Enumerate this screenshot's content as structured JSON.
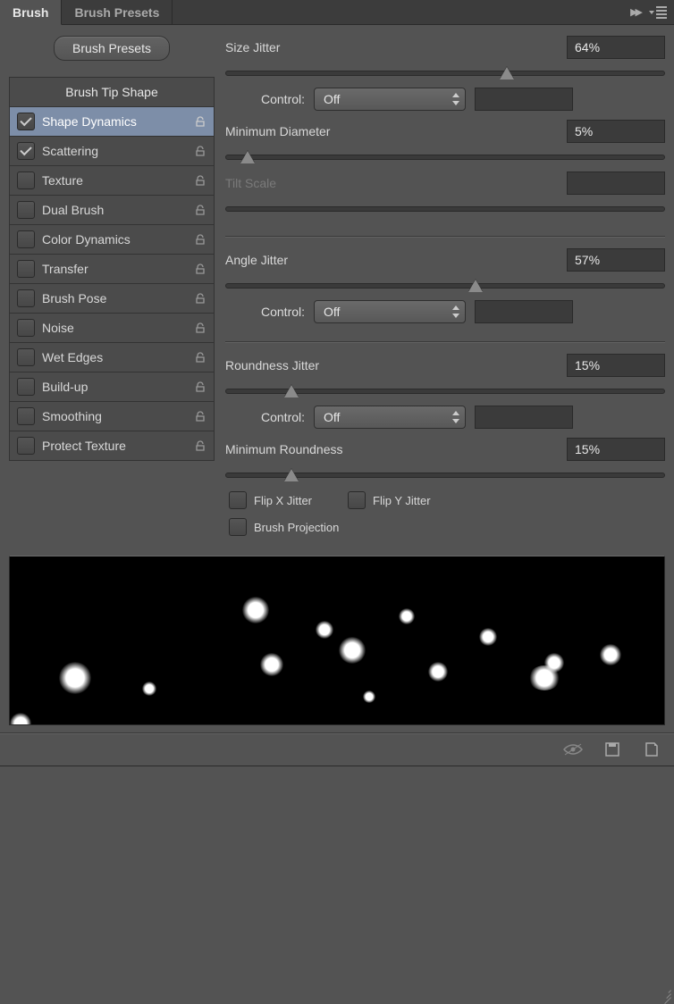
{
  "tabs": {
    "brush": "Brush",
    "presets": "Brush Presets"
  },
  "preset_button": "Brush Presets",
  "options_header": "Brush Tip Shape",
  "options": [
    {
      "label": "Shape Dynamics",
      "checked": true,
      "selected": true
    },
    {
      "label": "Scattering",
      "checked": true,
      "selected": false
    },
    {
      "label": "Texture",
      "checked": false,
      "selected": false
    },
    {
      "label": "Dual Brush",
      "checked": false,
      "selected": false
    },
    {
      "label": "Color Dynamics",
      "checked": false,
      "selected": false
    },
    {
      "label": "Transfer",
      "checked": false,
      "selected": false
    },
    {
      "label": "Brush Pose",
      "checked": false,
      "selected": false
    },
    {
      "label": "Noise",
      "checked": false,
      "selected": false
    },
    {
      "label": "Wet Edges",
      "checked": false,
      "selected": false
    },
    {
      "label": "Build-up",
      "checked": false,
      "selected": false
    },
    {
      "label": "Smoothing",
      "checked": false,
      "selected": false
    },
    {
      "label": "Protect Texture",
      "checked": false,
      "selected": false
    }
  ],
  "params": {
    "size_jitter": {
      "label": "Size Jitter",
      "value": "64%",
      "pos": 64
    },
    "control_label": "Control:",
    "control_off": "Off",
    "min_diameter": {
      "label": "Minimum Diameter",
      "value": "5%",
      "pos": 5
    },
    "tilt_scale": {
      "label": "Tilt Scale",
      "value": ""
    },
    "angle_jitter": {
      "label": "Angle Jitter",
      "value": "57%",
      "pos": 57
    },
    "roundness_jitter": {
      "label": "Roundness Jitter",
      "value": "15%",
      "pos": 15
    },
    "min_roundness": {
      "label": "Minimum Roundness",
      "value": "15%",
      "pos": 15
    },
    "flip_x": "Flip X Jitter",
    "flip_y": "Flip Y Jitter",
    "brush_projection": "Brush Projection"
  }
}
